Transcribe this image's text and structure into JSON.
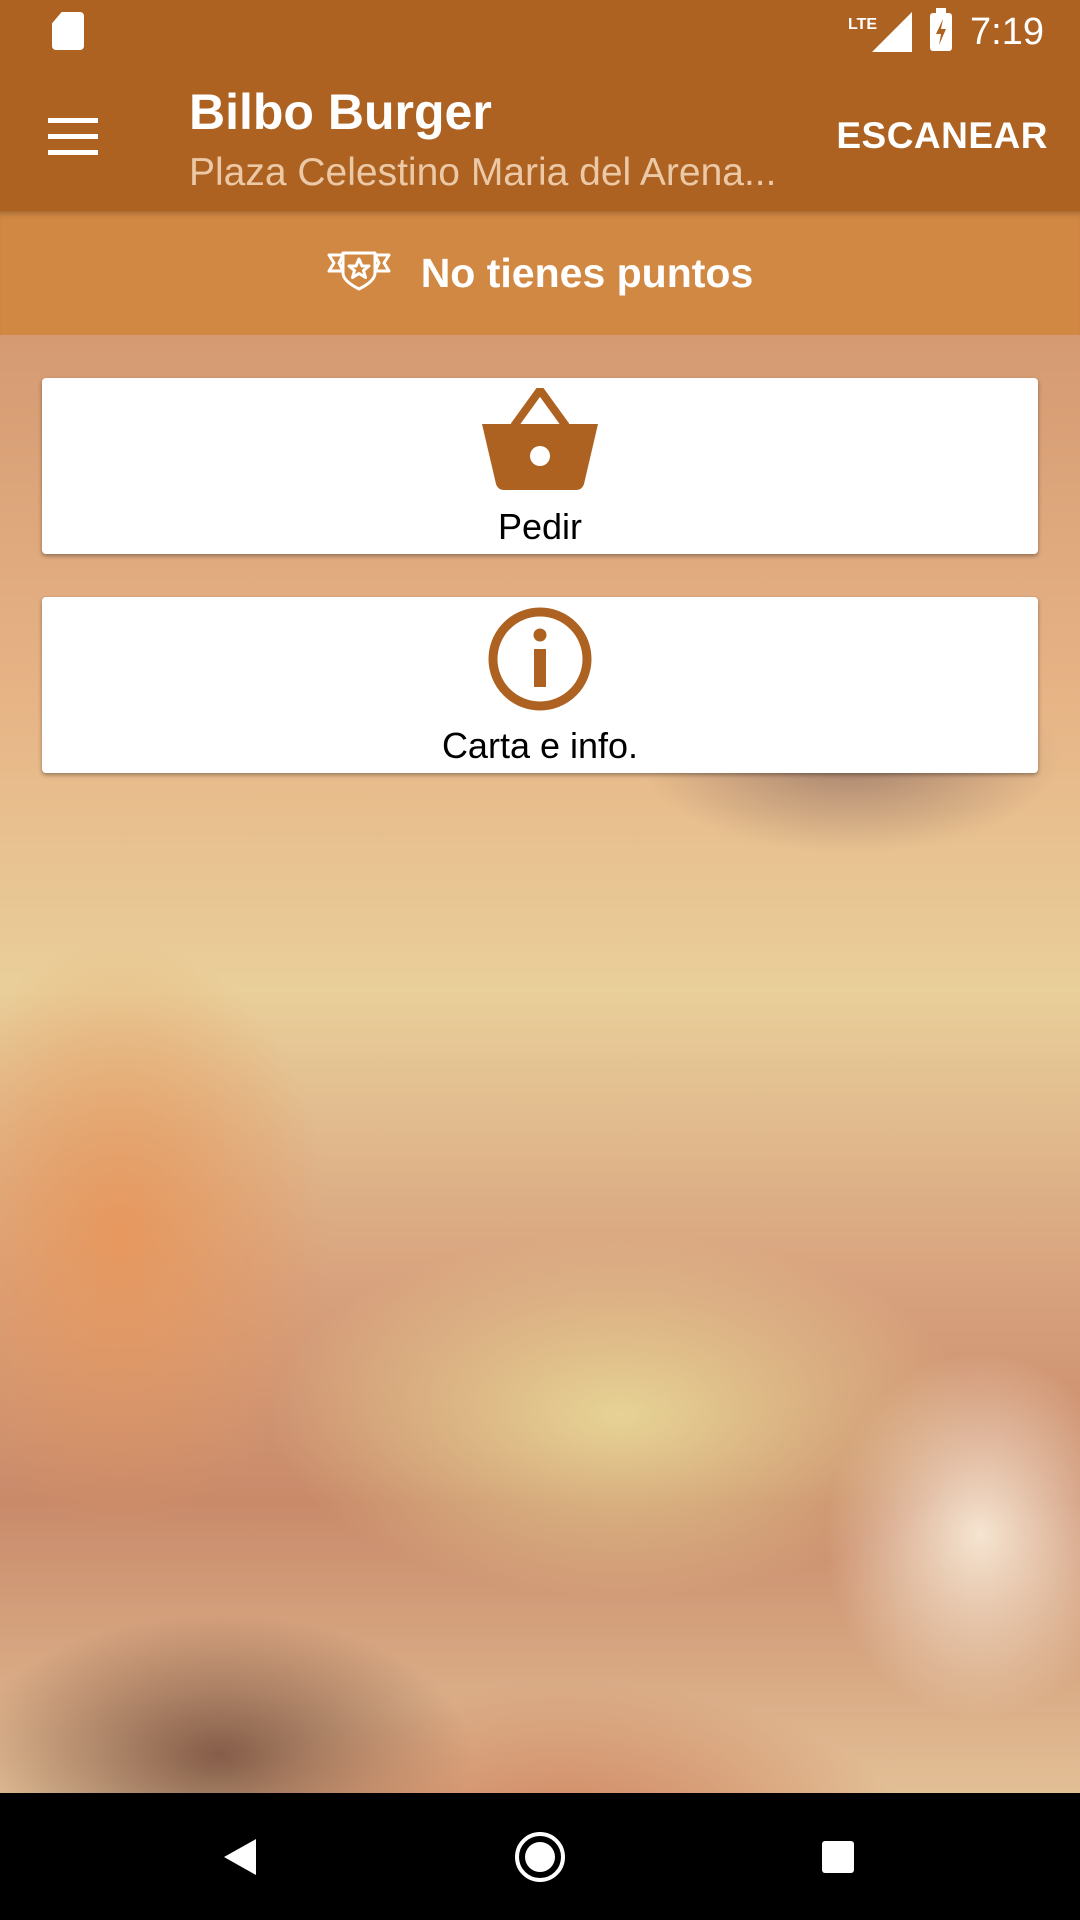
{
  "status_bar": {
    "network": "LTE",
    "time": "7:19"
  },
  "app_bar": {
    "title": "Bilbo Burger",
    "subtitle": "Plaza Celestino Maria del Arena...",
    "scan_label": "ESCANEAR"
  },
  "points": {
    "text": "No tienes puntos",
    "icon": "award-ribbon-icon"
  },
  "cards": {
    "order": {
      "label": "Pedir",
      "icon": "basket-icon"
    },
    "info": {
      "label": "Carta e info.",
      "icon": "info-icon"
    }
  },
  "nav": {
    "back": "back-icon",
    "home": "home-icon",
    "recents": "recents-icon"
  },
  "colors": {
    "primary": "#ad6221",
    "points_bar": "#d18843",
    "subtitle": "#ecc9a6"
  }
}
